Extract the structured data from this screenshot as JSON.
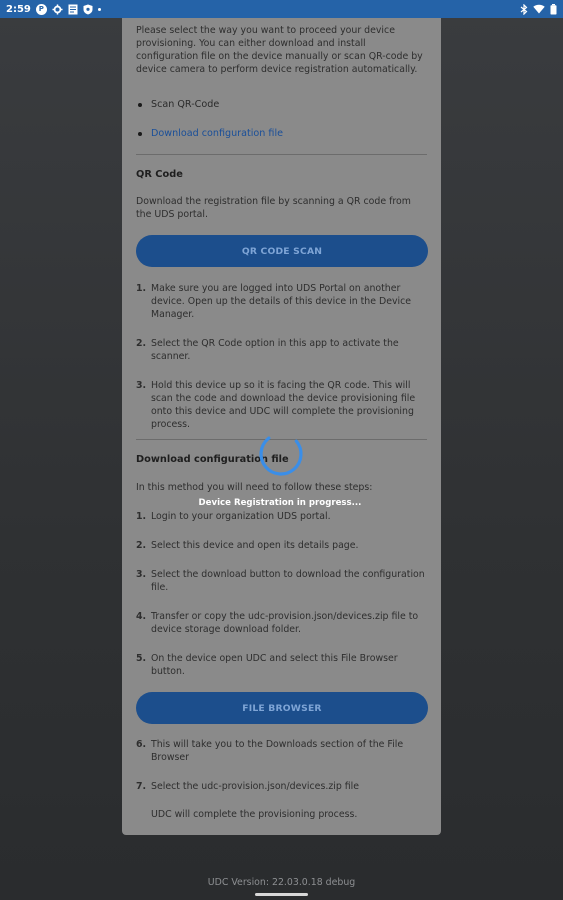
{
  "status_bar": {
    "time": "2:59",
    "left_icons": [
      "p-icon",
      "gear-icon",
      "document-icon",
      "shield-icon",
      "dot-icon"
    ],
    "right_icons": [
      "bluetooth-icon",
      "wifi-icon",
      "battery-icon"
    ]
  },
  "card": {
    "intro": "Please select the way you want to proceed your device provisioning. You can either download and install configuration file on the device manually or scan QR-code by device camera to perform device registration automatically.",
    "options": [
      {
        "label": "Scan QR-Code"
      },
      {
        "label": "Download configuration file"
      }
    ],
    "qr_section": {
      "title": "QR Code",
      "description": "Download the registration file by scanning a QR code from the UDS portal.",
      "button_label": "QR CODE SCAN",
      "steps": [
        {
          "num": "1.",
          "text": "Make sure you are logged into UDS Portal on another device. Open up the details of this device in the Device Manager."
        },
        {
          "num": "2.",
          "text": "Select the QR Code option in this app to activate the scanner."
        },
        {
          "num": "3.",
          "text": "Hold this device up so it is facing the QR code. This will scan the code and download the device provisioning file onto this device and UDC will complete the provisioning process."
        }
      ]
    },
    "download_section": {
      "title": "Download configuration file",
      "description": "In this method you will need to follow these steps:",
      "steps": [
        {
          "num": "1.",
          "text": "Login to your organization UDS portal."
        },
        {
          "num": "2.",
          "text": "Select this device and open its details page."
        },
        {
          "num": "3.",
          "text": "Select the download button to download the configuration file."
        },
        {
          "num": "4.",
          "text": "Transfer or copy the udc-provision.json/devices.zip file to device storage download folder."
        },
        {
          "num": "5.",
          "text": "On the device open UDC and select this File Browser button."
        }
      ],
      "button_label": "FILE BROWSER",
      "steps_after": [
        {
          "num": "6.",
          "text": "This will take you to the Downloads section of the File Browser"
        },
        {
          "num": "7.",
          "text": "Select the udc-provision.json/devices.zip file"
        }
      ],
      "closing": "UDC will complete the provisioning process."
    }
  },
  "overlay": {
    "progress_text": "Device Registration in progress..."
  },
  "footer": {
    "version": "UDC Version: 22.03.0.18 debug"
  },
  "colors": {
    "status_bar": "#2563a8",
    "button": "#1c4e8c",
    "button_text": "#7fa5d6",
    "link": "#1a4f99",
    "spinner": "#3a8ee8"
  }
}
